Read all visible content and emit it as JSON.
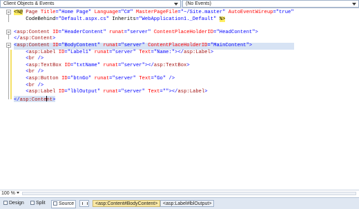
{
  "topbar": {
    "left_dropdown": "Client Objects & Events",
    "right_dropdown": "(No Events)"
  },
  "code_lines": [
    "<%@ Page Title=\"Home Page\" Language=\"C#\" MasterPageFile=\"~/Site.master\" AutoEventWireup=\"true\"",
    "    CodeBehind=\"Default.aspx.cs\" Inherits=\"WebApplication1._Default\" %>",
    "",
    "<asp:Content ID=\"HeaderContent\" runat=\"server\" ContentPlaceHolderID=\"HeadContent\">",
    "</asp:Content>",
    "<asp:Content ID=\"BodyContent\" runat=\"server\" ContentPlaceHolderID=\"MainContent\">",
    "    <asp:Label ID=\"Label1\" runat=\"server\" Text=\"Name:\"></asp:Label>",
    "    <br />",
    "    <asp:TextBox ID=\"txtName\" runat=\"server\"></asp:TextBox>",
    "    <br />",
    "    <asp:Button ID=\"btnGo\" runat=\"server\" Text=\"Go\" />",
    "    <br />",
    "    <asp:Label ID=\"lblOutput\" runat=\"server\" Text=\"\"></asp:Label>",
    "</asp:Content>"
  ],
  "status": {
    "zoom": "100 %"
  },
  "bottombar": {
    "design_label": "Design",
    "split_label": "Split",
    "source_label": "Source",
    "crumbs": [
      "<asp:Content#BodyContent>",
      "<asp:Label#lblOutput>"
    ]
  },
  "colors": {
    "tag": "#a31515",
    "attribute": "#ff0000",
    "value": "#0000ff",
    "directive_highlight": "#ffee62",
    "current_block_highlight": "#d7e3f4"
  }
}
